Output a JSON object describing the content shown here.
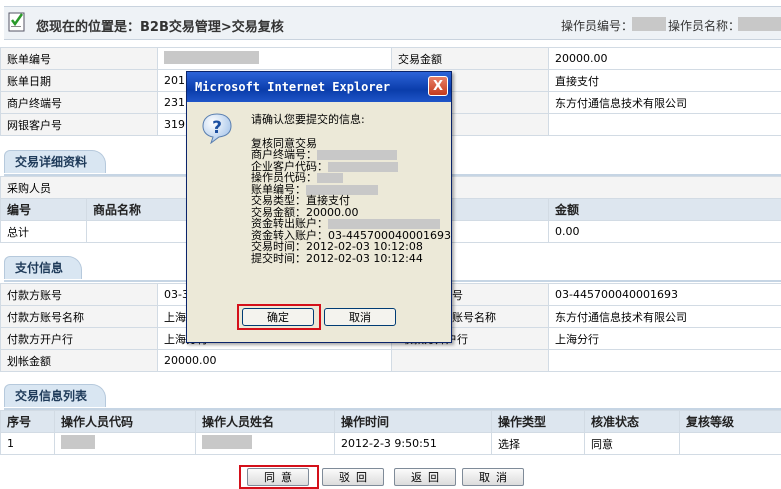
{
  "header": {
    "location_text": "您现在的位置是：B2B交易管理>交易复核",
    "operator_id_label": "操作员编号：",
    "operator_name_label": "操作员名称："
  },
  "info": {
    "bill_no_label": "账单编号",
    "bill_date_label": "账单日期",
    "bill_date_value": "201",
    "merchant_no_label": "商户终端号",
    "merchant_no_value": "231",
    "bank_customer_label": "网银客户号",
    "bank_customer_value": "319",
    "amount_label": "交易金额",
    "amount_value": "20000.00",
    "pay_type_value": "直接支付",
    "company_value": "东方付通信息技术有限公司"
  },
  "detail": {
    "section_title": "交易详细资料",
    "buyer_label": "采购人员",
    "headers": [
      "编号",
      "商品名称",
      "金额"
    ],
    "total_label": "总计",
    "total_value": "0.00"
  },
  "payment": {
    "section_title": "支付信息",
    "payer_account_label": "付款方账号",
    "payer_account_value": "03-3",
    "payer_name_label": "付款方账号名称",
    "payer_name_value": "上海",
    "payer_bank_label": "付款方开户行",
    "payer_bank_value": "上海分行",
    "transfer_amount_label": "划帐金额",
    "transfer_amount_value": "20000.00",
    "payee_account_value": "03-445700040001693",
    "payee_name_label_partial": "号",
    "payee_name_label2_partial": "账号名称",
    "payee_name_value": "东方付通信息技术有限公司",
    "payee_bank_label_partial": "收款方开户行",
    "payee_bank_value": "上海分行"
  },
  "tx_list": {
    "section_title": "交易信息列表",
    "headers": [
      "序号",
      "操作人员代码",
      "操作人员姓名",
      "操作时间",
      "操作类型",
      "核准状态",
      "复核等级"
    ],
    "rows": [
      {
        "seq": "1",
        "time": "2012-2-3 9:50:51",
        "type": "选择",
        "status": "同意"
      }
    ]
  },
  "buttons": {
    "agree": "同意",
    "reject": "驳回",
    "back": "返回",
    "cancel": "取消"
  },
  "dialog": {
    "title": "Microsoft Internet Explorer",
    "close": "X",
    "prompt": "请确认您要提交的信息:",
    "lines": [
      "复核同意交易",
      "商户终端号：",
      "企业客户代码：",
      "操作员代码：",
      "账单编号：",
      "交易类型：直接支付",
      "交易金额：20000.00",
      "资金转出账户：",
      "资金转入账户：03-445700040001693",
      "交易时间：2012-02-03 10:12:08",
      "提交时间：2012-02-03 10:12:44"
    ],
    "ok": "确定",
    "cancel": "取消"
  }
}
